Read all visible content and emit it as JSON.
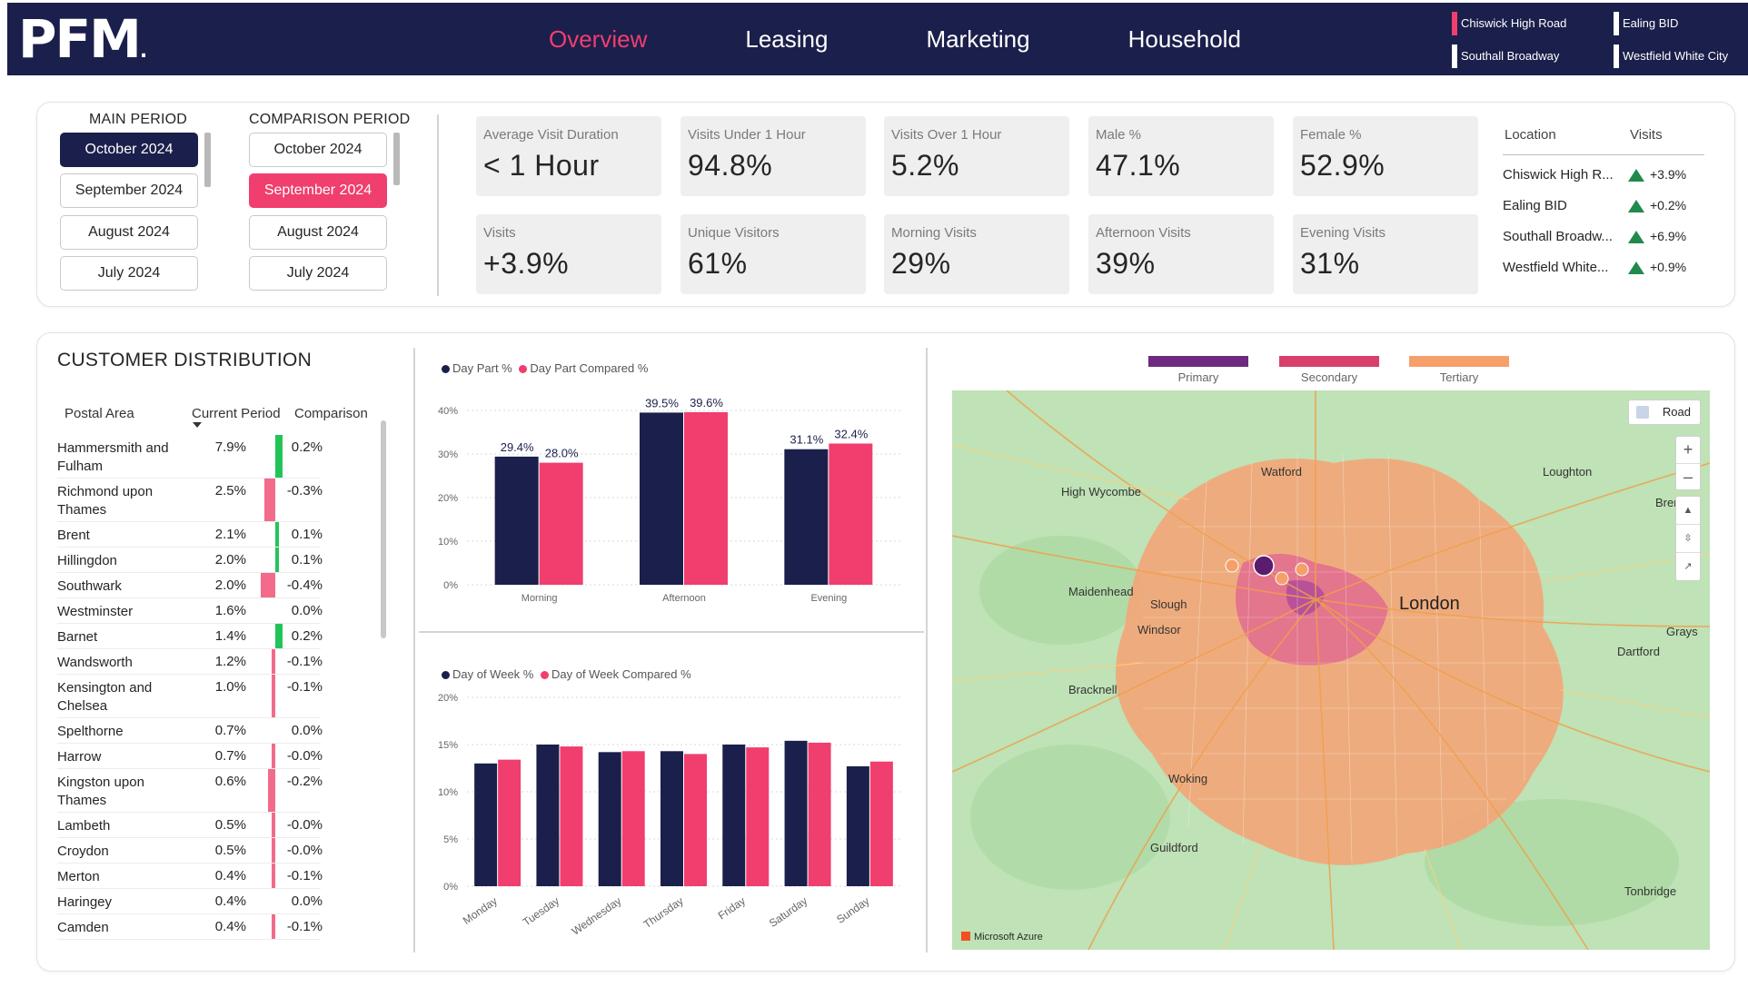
{
  "header": {
    "logo": "PFM",
    "nav": [
      "Overview",
      "Leasing",
      "Marketing",
      "Household"
    ],
    "sites": [
      {
        "label": "Chiswick High Road",
        "color": "#f03e6e"
      },
      {
        "label": "Ealing BID",
        "color": "#ffffff"
      },
      {
        "label": "Southall Broadway",
        "color": "#ffffff"
      },
      {
        "label": "Westfield White City",
        "color": "#ffffff"
      }
    ]
  },
  "periods": {
    "main_title": "MAIN PERIOD",
    "comparison_title": "COMPARISON PERIOD",
    "main": [
      "October 2024",
      "September 2024",
      "August 2024",
      "July 2024"
    ],
    "comparison": [
      "October 2024",
      "September 2024",
      "August 2024",
      "July 2024"
    ],
    "main_selected": "October 2024",
    "comparison_selected": "September 2024"
  },
  "kpis": [
    {
      "label": "Average Visit Duration",
      "value": "< 1 Hour"
    },
    {
      "label": "Visits Under 1 Hour",
      "value": "94.8%"
    },
    {
      "label": "Visits Over 1 Hour",
      "value": "5.2%"
    },
    {
      "label": "Male %",
      "value": "47.1%"
    },
    {
      "label": "Female %",
      "value": "52.9%"
    },
    {
      "label": "Visits",
      "value": "+3.9%"
    },
    {
      "label": "Unique Visitors",
      "value": "61%"
    },
    {
      "label": "Morning Visits",
      "value": "29%"
    },
    {
      "label": "Afternoon Visits",
      "value": "39%"
    },
    {
      "label": "Evening Visits",
      "value": "31%"
    }
  ],
  "locations": {
    "headers": [
      "Location",
      "Visits"
    ],
    "rows": [
      {
        "name": "Chiswick High R...",
        "visits": "+3.9%"
      },
      {
        "name": "Ealing BID",
        "visits": "+0.2%"
      },
      {
        "name": "Southall Broadw...",
        "visits": "+6.9%"
      },
      {
        "name": "Westfield White...",
        "visits": "+0.9%"
      }
    ]
  },
  "customer_distribution": {
    "title": "CUSTOMER DISTRIBUTION",
    "headers": [
      "Postal Area",
      "Current Period",
      "Comparison"
    ],
    "rows": [
      {
        "area": "Hammersmith and Fulham",
        "current": "7.9%",
        "comparison": "0.2%",
        "delta": 0.2
      },
      {
        "area": "Richmond upon Thames",
        "current": "2.5%",
        "comparison": "-0.3%",
        "delta": -0.3
      },
      {
        "area": "Brent",
        "current": "2.1%",
        "comparison": "0.1%",
        "delta": 0.1
      },
      {
        "area": "Hillingdon",
        "current": "2.0%",
        "comparison": "0.1%",
        "delta": 0.1
      },
      {
        "area": "Southwark",
        "current": "2.0%",
        "comparison": "-0.4%",
        "delta": -0.4
      },
      {
        "area": "Westminster",
        "current": "1.6%",
        "comparison": "0.0%",
        "delta": 0.0
      },
      {
        "area": "Barnet",
        "current": "1.4%",
        "comparison": "0.2%",
        "delta": 0.2
      },
      {
        "area": "Wandsworth",
        "current": "1.2%",
        "comparison": "-0.1%",
        "delta": -0.1
      },
      {
        "area": "Kensington and Chelsea",
        "current": "1.0%",
        "comparison": "-0.1%",
        "delta": -0.1
      },
      {
        "area": "Spelthorne",
        "current": "0.7%",
        "comparison": "0.0%",
        "delta": 0.0
      },
      {
        "area": "Harrow",
        "current": "0.7%",
        "comparison": "-0.0%",
        "delta": -0.02
      },
      {
        "area": "Kingston upon Thames",
        "current": "0.6%",
        "comparison": "-0.2%",
        "delta": -0.2
      },
      {
        "area": "Lambeth",
        "current": "0.5%",
        "comparison": "-0.0%",
        "delta": -0.02
      },
      {
        "area": "Croydon",
        "current": "0.5%",
        "comparison": "-0.0%",
        "delta": -0.02
      },
      {
        "area": "Merton",
        "current": "0.4%",
        "comparison": "-0.1%",
        "delta": -0.1
      },
      {
        "area": "Haringey",
        "current": "0.4%",
        "comparison": "0.0%",
        "delta": 0.0
      },
      {
        "area": "Camden",
        "current": "0.4%",
        "comparison": "-0.1%",
        "delta": -0.1
      }
    ],
    "positive_color": "#22c45a",
    "negative_color": "#f26b8a"
  },
  "chart_data": [
    {
      "type": "bar",
      "categories": [
        "Morning",
        "Afternoon",
        "Evening"
      ],
      "series": [
        {
          "name": "Day Part %",
          "color": "#1b1f4b",
          "values": [
            29.4,
            39.5,
            31.1
          ]
        },
        {
          "name": "Day Part Compared %",
          "color": "#f03e6e",
          "values": [
            28.0,
            39.6,
            32.4
          ]
        }
      ],
      "data_labels": [
        [
          "29.4%",
          "39.5%",
          "31.1%"
        ],
        [
          "28.0%",
          "39.6%",
          "32.4%"
        ]
      ],
      "yticks": [
        "0%",
        "10%",
        "20%",
        "30%",
        "40%"
      ],
      "ylim": [
        0,
        40
      ],
      "grid": true,
      "legend": "top-left"
    },
    {
      "type": "bar",
      "categories": [
        "Monday",
        "Tuesday",
        "Wednesday",
        "Thursday",
        "Friday",
        "Saturday",
        "Sunday"
      ],
      "series": [
        {
          "name": "Day of Week %",
          "color": "#1b1f4b",
          "values": [
            13.0,
            15.0,
            14.2,
            14.3,
            15.0,
            15.4,
            12.7
          ]
        },
        {
          "name": "Day of Week Compared %",
          "color": "#f03e6e",
          "values": [
            13.4,
            14.8,
            14.3,
            14.0,
            14.7,
            15.2,
            13.2
          ]
        }
      ],
      "yticks": [
        "0%",
        "5%",
        "10%",
        "15%",
        "20%"
      ],
      "ylim": [
        0,
        20
      ],
      "grid": true,
      "legend": "top-left"
    }
  ],
  "map": {
    "legend": [
      {
        "label": "Primary",
        "color": "#6d2b7f"
      },
      {
        "label": "Secondary",
        "color": "#d8406b"
      },
      {
        "label": "Tertiary",
        "color": "#f5a06a"
      }
    ],
    "style_button": "Road",
    "places": [
      "Watford",
      "Loughton",
      "High Wycombe",
      "Maidenhead",
      "Slough",
      "Windsor",
      "London",
      "Bracknell",
      "Woking",
      "Guildford",
      "Dartford",
      "Grays",
      "Tonbridge",
      "Brent"
    ],
    "attribution": "Microsoft Azure",
    "zoom_in": "+",
    "zoom_out": "–"
  }
}
